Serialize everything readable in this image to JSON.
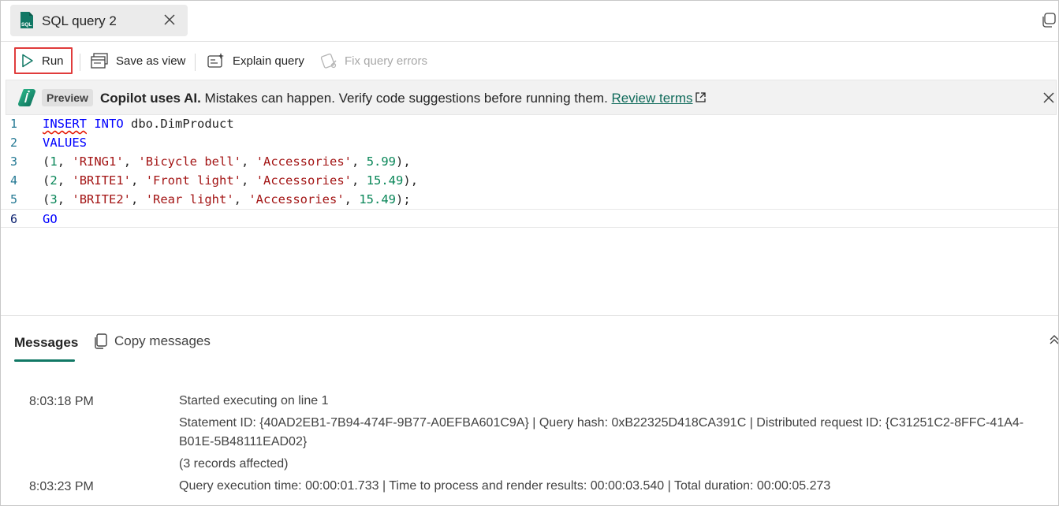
{
  "tab": {
    "title": "SQL query 2",
    "icon": "sql-file-icon"
  },
  "toolbar": {
    "run_label": "Run",
    "save_view_label": "Save as view",
    "explain_label": "Explain query",
    "fix_label": "Fix query errors"
  },
  "banner": {
    "preview_label": "Preview",
    "strong_text": "Copilot uses AI.",
    "text": " Mistakes can happen. Verify code suggestions before running them. ",
    "link_text": "Review terms"
  },
  "editor": {
    "line_numbers": [
      "1",
      "2",
      "3",
      "4",
      "5",
      "6"
    ],
    "lines": [
      [
        {
          "t": "INSERT",
          "c": "kw squiggle"
        },
        {
          "t": " ",
          "c": ""
        },
        {
          "t": "INTO",
          "c": "kw"
        },
        {
          "t": " dbo.DimProduct",
          "c": ""
        }
      ],
      [
        {
          "t": "VALUES",
          "c": "kw"
        }
      ],
      [
        {
          "t": "(",
          "c": ""
        },
        {
          "t": "1",
          "c": "num"
        },
        {
          "t": ", ",
          "c": ""
        },
        {
          "t": "'RING1'",
          "c": "str"
        },
        {
          "t": ", ",
          "c": ""
        },
        {
          "t": "'Bicycle bell'",
          "c": "str"
        },
        {
          "t": ", ",
          "c": ""
        },
        {
          "t": "'Accessories'",
          "c": "str"
        },
        {
          "t": ", ",
          "c": ""
        },
        {
          "t": "5.99",
          "c": "num"
        },
        {
          "t": "),",
          "c": ""
        }
      ],
      [
        {
          "t": "(",
          "c": ""
        },
        {
          "t": "2",
          "c": "num"
        },
        {
          "t": ", ",
          "c": ""
        },
        {
          "t": "'BRITE1'",
          "c": "str"
        },
        {
          "t": ", ",
          "c": ""
        },
        {
          "t": "'Front light'",
          "c": "str"
        },
        {
          "t": ", ",
          "c": ""
        },
        {
          "t": "'Accessories'",
          "c": "str"
        },
        {
          "t": ", ",
          "c": ""
        },
        {
          "t": "15.49",
          "c": "num"
        },
        {
          "t": "),",
          "c": ""
        }
      ],
      [
        {
          "t": "(",
          "c": ""
        },
        {
          "t": "3",
          "c": "num"
        },
        {
          "t": ", ",
          "c": ""
        },
        {
          "t": "'BRITE2'",
          "c": "str"
        },
        {
          "t": ", ",
          "c": ""
        },
        {
          "t": "'Rear light'",
          "c": "str"
        },
        {
          "t": ", ",
          "c": ""
        },
        {
          "t": "'Accessories'",
          "c": "str"
        },
        {
          "t": ", ",
          "c": ""
        },
        {
          "t": "15.49",
          "c": "num"
        },
        {
          "t": ");",
          "c": ""
        }
      ],
      [
        {
          "t": "GO",
          "c": "kw"
        }
      ]
    ]
  },
  "messages_panel": {
    "tab_label": "Messages",
    "copy_label": "Copy messages",
    "entries": [
      {
        "time": "8:03:18 PM",
        "lines": [
          "Started executing on line 1",
          "Statement ID: {40AD2EB1-7B94-474F-9B77-A0EFBA601C9A} | Query hash: 0xB22325D418CA391C | Distributed request ID: {C31251C2-8FFC-41A4-B01E-5B48111EAD02}",
          "(3 records affected)"
        ]
      },
      {
        "time": "8:03:23 PM",
        "lines": [
          "Query execution time: 00:00:01.733 | Time to process and render results: 00:00:03.540 | Total duration: 00:00:05.273"
        ]
      }
    ]
  },
  "colors": {
    "accent": "#117865",
    "keyword": "#0000ff",
    "string": "#a31515",
    "number": "#098658",
    "run_highlight": "#e03c3c"
  }
}
